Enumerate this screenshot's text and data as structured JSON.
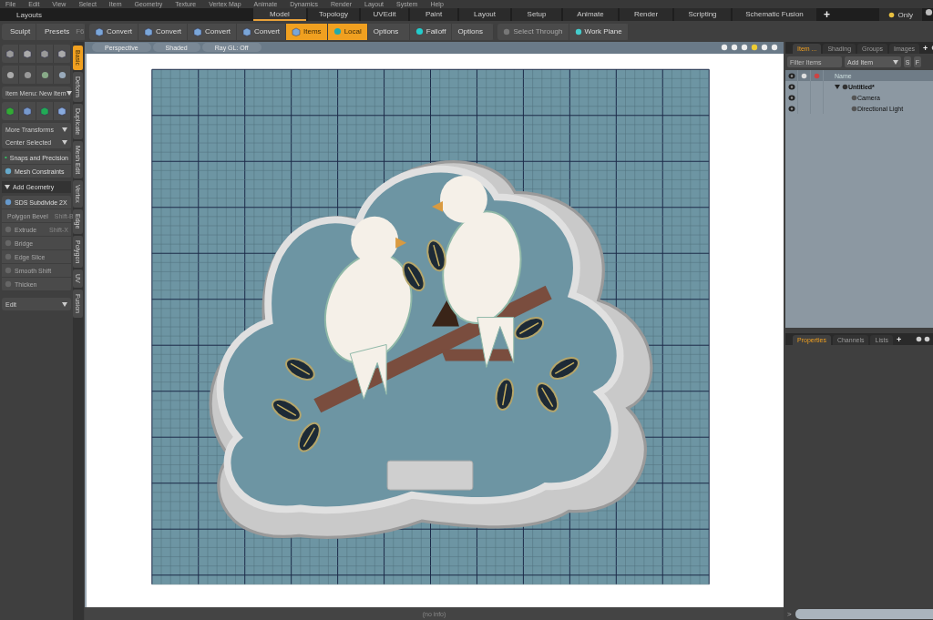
{
  "menu_bar": [
    "File",
    "Edit",
    "View",
    "Select",
    "Item",
    "Geometry",
    "Texture",
    "Vertex Map",
    "Animate",
    "Dynamics",
    "Render",
    "Layout",
    "System",
    "Help"
  ],
  "layouts_bar": {
    "label": "Layouts",
    "tabs": [
      {
        "label": "Model",
        "selected": true
      },
      {
        "label": "Topology",
        "selected": false
      },
      {
        "label": "UVEdit",
        "selected": false
      },
      {
        "label": "Paint",
        "selected": false
      },
      {
        "label": "Layout",
        "selected": false
      },
      {
        "label": "Setup",
        "selected": false
      },
      {
        "label": "Animate",
        "selected": false
      },
      {
        "label": "Render",
        "selected": false
      },
      {
        "label": "Scripting",
        "selected": false
      },
      {
        "label": "Schematic Fusion",
        "selected": false
      }
    ],
    "add": "+",
    "only": "Only"
  },
  "toolbar": {
    "left": [
      {
        "label": "Sculpt"
      },
      {
        "label": "Presets",
        "shortcut": "F6"
      }
    ],
    "tools": [
      {
        "label": "Convert",
        "active": false,
        "disabled": false
      },
      {
        "label": "Convert",
        "active": false,
        "disabled": false
      },
      {
        "label": "Convert",
        "active": false,
        "disabled": false
      },
      {
        "label": "Convert",
        "active": false,
        "disabled": false
      },
      {
        "label": "Items",
        "active": true,
        "disabled": false
      },
      {
        "label": "Local",
        "active": true,
        "disabled": false
      },
      {
        "label": "Options",
        "active": false,
        "disabled": false
      },
      {
        "label": "Falloff",
        "active": false,
        "disabled": false
      },
      {
        "label": "Options",
        "active": false,
        "disabled": false
      },
      {
        "label": "Select Through",
        "active": false,
        "disabled": true
      },
      {
        "label": "Work Plane",
        "active": false,
        "disabled": false
      }
    ]
  },
  "left_panel": {
    "dropdowns_top": [
      "Item Menu: New Item"
    ],
    "transforms": [
      "More Transforms",
      "Center Selected"
    ],
    "snaps": [
      "Snaps and Precision",
      "Mesh Constraints"
    ],
    "section": {
      "label": "Add Geometry",
      "expanded": true
    },
    "tools": [
      {
        "label": "SDS Subdivide 2X",
        "disabled": false
      },
      {
        "label": "Polygon Bevel",
        "shortcut": "Shift-B",
        "disabled": true
      },
      {
        "label": "Extrude",
        "shortcut": "Shift-X",
        "disabled": true
      },
      {
        "label": "Bridge",
        "disabled": true
      },
      {
        "label": "Edge Slice",
        "disabled": true
      },
      {
        "label": "Smooth Shift",
        "disabled": true
      },
      {
        "label": "Thicken",
        "disabled": true
      }
    ],
    "bottom_dropdown": "Edit",
    "vertical_tabs": [
      {
        "label": "Basic",
        "selected": true
      },
      {
        "label": "Deform",
        "selected": false
      },
      {
        "label": "Duplicate",
        "selected": false
      },
      {
        "label": "Mesh Edit",
        "selected": false
      },
      {
        "label": "Vertex",
        "selected": false
      },
      {
        "label": "Edge",
        "selected": false
      },
      {
        "label": "Polygon",
        "selected": false
      },
      {
        "label": "UV",
        "selected": false
      },
      {
        "label": "Fusion",
        "selected": false
      }
    ]
  },
  "viewport": {
    "header": [
      "Perspective",
      "Shaded",
      "Ray GL: Off"
    ]
  },
  "item_panel": {
    "tabs": [
      {
        "label": "Item ...",
        "selected": true
      },
      {
        "label": "Shading",
        "selected": false
      },
      {
        "label": "Groups",
        "selected": false
      },
      {
        "label": "Images",
        "selected": false
      }
    ],
    "add": "+",
    "filter_placeholder": "Filter Items",
    "add_item": "Add Item",
    "buttons": [
      "S",
      "F"
    ],
    "column": "Name",
    "tree": [
      {
        "name": "Untitled*",
        "expanded": true,
        "children": [
          {
            "name": "Camera"
          },
          {
            "name": "Directional Light"
          }
        ]
      }
    ]
  },
  "properties_panel": {
    "tabs": [
      {
        "label": "Properties",
        "selected": true
      },
      {
        "label": "Channels",
        "selected": false
      },
      {
        "label": "Lists",
        "selected": false
      }
    ],
    "add": "+"
  },
  "status_bar": {
    "info": "(no info)",
    "prompt": ">"
  }
}
